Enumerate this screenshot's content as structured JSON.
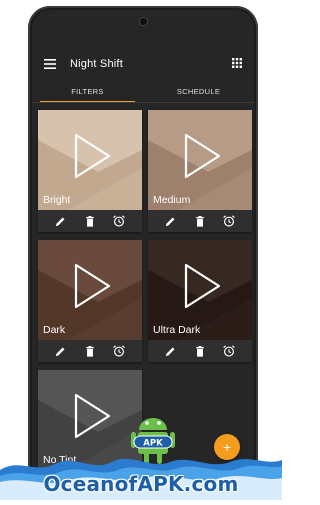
{
  "app": {
    "title": "Night Shift"
  },
  "tabs": [
    {
      "label": "FILTERS",
      "active": true
    },
    {
      "label": "SCHEDULE",
      "active": false
    }
  ],
  "filters": [
    {
      "label": "Bright",
      "colors": [
        "#cbb39a",
        "#c2a88f",
        "#d7c2ad"
      ]
    },
    {
      "label": "Medium",
      "colors": [
        "#a88c77",
        "#9d816d",
        "#b69b86"
      ]
    },
    {
      "label": "Dark",
      "colors": [
        "#5c3f33",
        "#533729",
        "#694a3d"
      ]
    },
    {
      "label": "Ultra Dark",
      "colors": [
        "#2d1f1a",
        "#261915",
        "#382822"
      ]
    },
    {
      "label": "No Tint",
      "colors": [
        "#4a4a4a",
        "#424242",
        "#555555"
      ]
    }
  ],
  "card_actions": [
    "edit-icon",
    "delete-icon",
    "alarm-icon"
  ],
  "fab": {
    "label": "+"
  },
  "watermark": {
    "text": "OceanofAPK.com",
    "badge": "APK"
  },
  "accent": "#f2a33a"
}
